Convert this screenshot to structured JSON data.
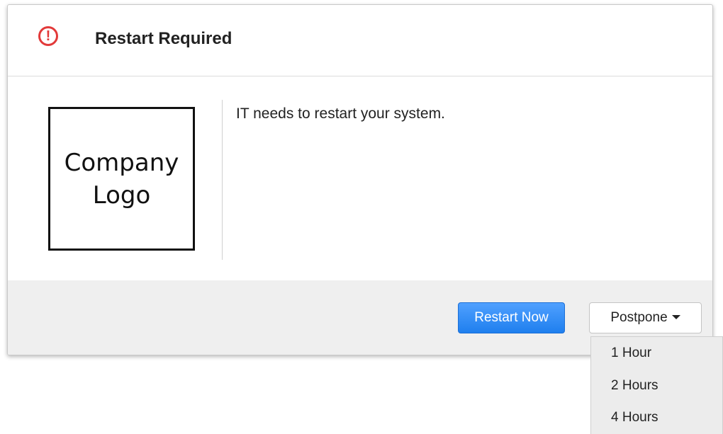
{
  "dialog": {
    "title": "Restart Required",
    "alert_icon": "exclamation-circle-icon",
    "alert_glyph": "!",
    "alert_color": "#e23a3a",
    "logo": {
      "line1": "Company",
      "line2": "Logo"
    },
    "message": "IT needs to restart your system."
  },
  "footer": {
    "restart_label": "Restart Now",
    "postpone_label": "Postpone",
    "primary_color": "#2a88f5"
  },
  "postpone_menu": {
    "items": [
      {
        "label": "1 Hour"
      },
      {
        "label": "2 Hours"
      },
      {
        "label": "4 Hours"
      }
    ]
  }
}
